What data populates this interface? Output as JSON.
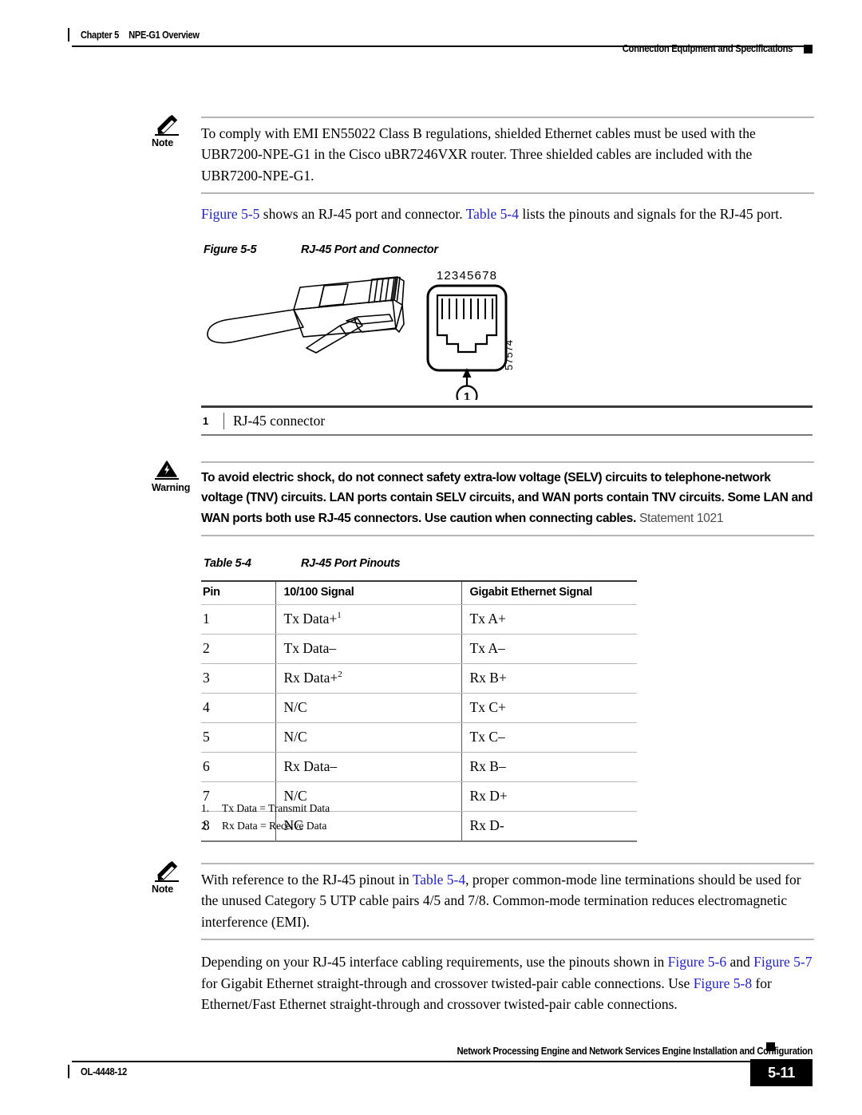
{
  "header": {
    "chapter": "Chapter 5",
    "chapter_title": "NPE-G1 Overview",
    "section": "Connection Equipment and Specifications"
  },
  "note_top": {
    "label": "Note",
    "icon": "pencil-icon",
    "text": "To comply with EMI EN55022 Class B regulations, shielded Ethernet cables must be used with the UBR7200-NPE-G1 in the Cisco uBR7246VXR router. Three shielded cables are included with the UBR7200-NPE-G1."
  },
  "intro_paragraph": {
    "link1": "Figure 5-5",
    "mid": " shows an RJ-45 port and connector. ",
    "link2": "Table 5-4",
    "tail": " lists the pinouts and signals for the RJ-45 port."
  },
  "figure": {
    "number": "Figure 5-5",
    "title": "RJ-45 Port and Connector",
    "pin_numbers": "12345678",
    "callout_marker": "1",
    "art_id": "57574",
    "legend": {
      "number": "1",
      "description": "RJ-45 connector"
    }
  },
  "warning": {
    "label": "Warning",
    "icon": "warning-triangle-icon",
    "text": "To avoid electric shock, do not connect safety extra-low voltage (SELV) circuits to telephone-network voltage (TNV) circuits. LAN ports contain SELV circuits, and WAN ports contain TNV circuits. Some LAN and WAN ports both use RJ-45 connectors. Use caution when connecting cables.",
    "statement": "Statement 1021"
  },
  "table": {
    "number": "Table 5-4",
    "title": "RJ-45 Port Pinouts",
    "columns": [
      "Pin",
      "10/100 Signal",
      "Gigabit Ethernet Signal"
    ],
    "rows": [
      {
        "pin": "1",
        "signal_10_100": "Tx Data+",
        "footnote": "1",
        "gigabit": "Tx A+"
      },
      {
        "pin": "2",
        "signal_10_100": "Tx Data–",
        "footnote": "",
        "gigabit": "Tx A–"
      },
      {
        "pin": "3",
        "signal_10_100": "Rx Data+",
        "footnote": "2",
        "gigabit": "Rx B+"
      },
      {
        "pin": "4",
        "signal_10_100": "N/C",
        "footnote": "",
        "gigabit": "Tx C+"
      },
      {
        "pin": "5",
        "signal_10_100": "N/C",
        "footnote": "",
        "gigabit": "Tx C–"
      },
      {
        "pin": "6",
        "signal_10_100": "Rx Data–",
        "footnote": "",
        "gigabit": "Rx B–"
      },
      {
        "pin": "7",
        "signal_10_100": "N/C",
        "footnote": "",
        "gigabit": "Rx D+"
      },
      {
        "pin": "8",
        "signal_10_100": "NC",
        "footnote": "",
        "gigabit": "Rx D-"
      }
    ],
    "footnotes": [
      {
        "num": "1.",
        "text": "Tx Data = Transmit Data"
      },
      {
        "num": "2.",
        "text": "Rx Data = Receive Data"
      }
    ]
  },
  "note_bottom": {
    "label": "Note",
    "icon": "pencil-icon",
    "lead": "With reference to the RJ-45 pinout in ",
    "link": "Table 5-4",
    "tail": ", proper common-mode line terminations should be used for the unused Category 5 UTP cable pairs 4/5 and 7/8. Common-mode termination reduces electromagnetic interference (EMI)."
  },
  "closing_paragraph": {
    "part1": "Depending on your RJ-45 interface cabling requirements, use the pinouts shown in ",
    "link1": "Figure 5-6",
    "part2": " and ",
    "link2": "Figure 5-7",
    "part3": " for Gigabit Ethernet straight-through and crossover twisted-pair cable connections. Use ",
    "link3": "Figure 5-8",
    "part4": " for Ethernet/Fast Ethernet straight-through and crossover twisted-pair cable connections."
  },
  "footer": {
    "title": "Network Processing Engine and Network Services Engine Installation and Configuration",
    "doc_id": "OL-4448-12",
    "page_number": "5-11"
  },
  "colors": {
    "xref_link": "#2020d0",
    "rule": "#000000",
    "admon_rule": "#b5b5b5",
    "page_badge_bg": "#000000"
  }
}
